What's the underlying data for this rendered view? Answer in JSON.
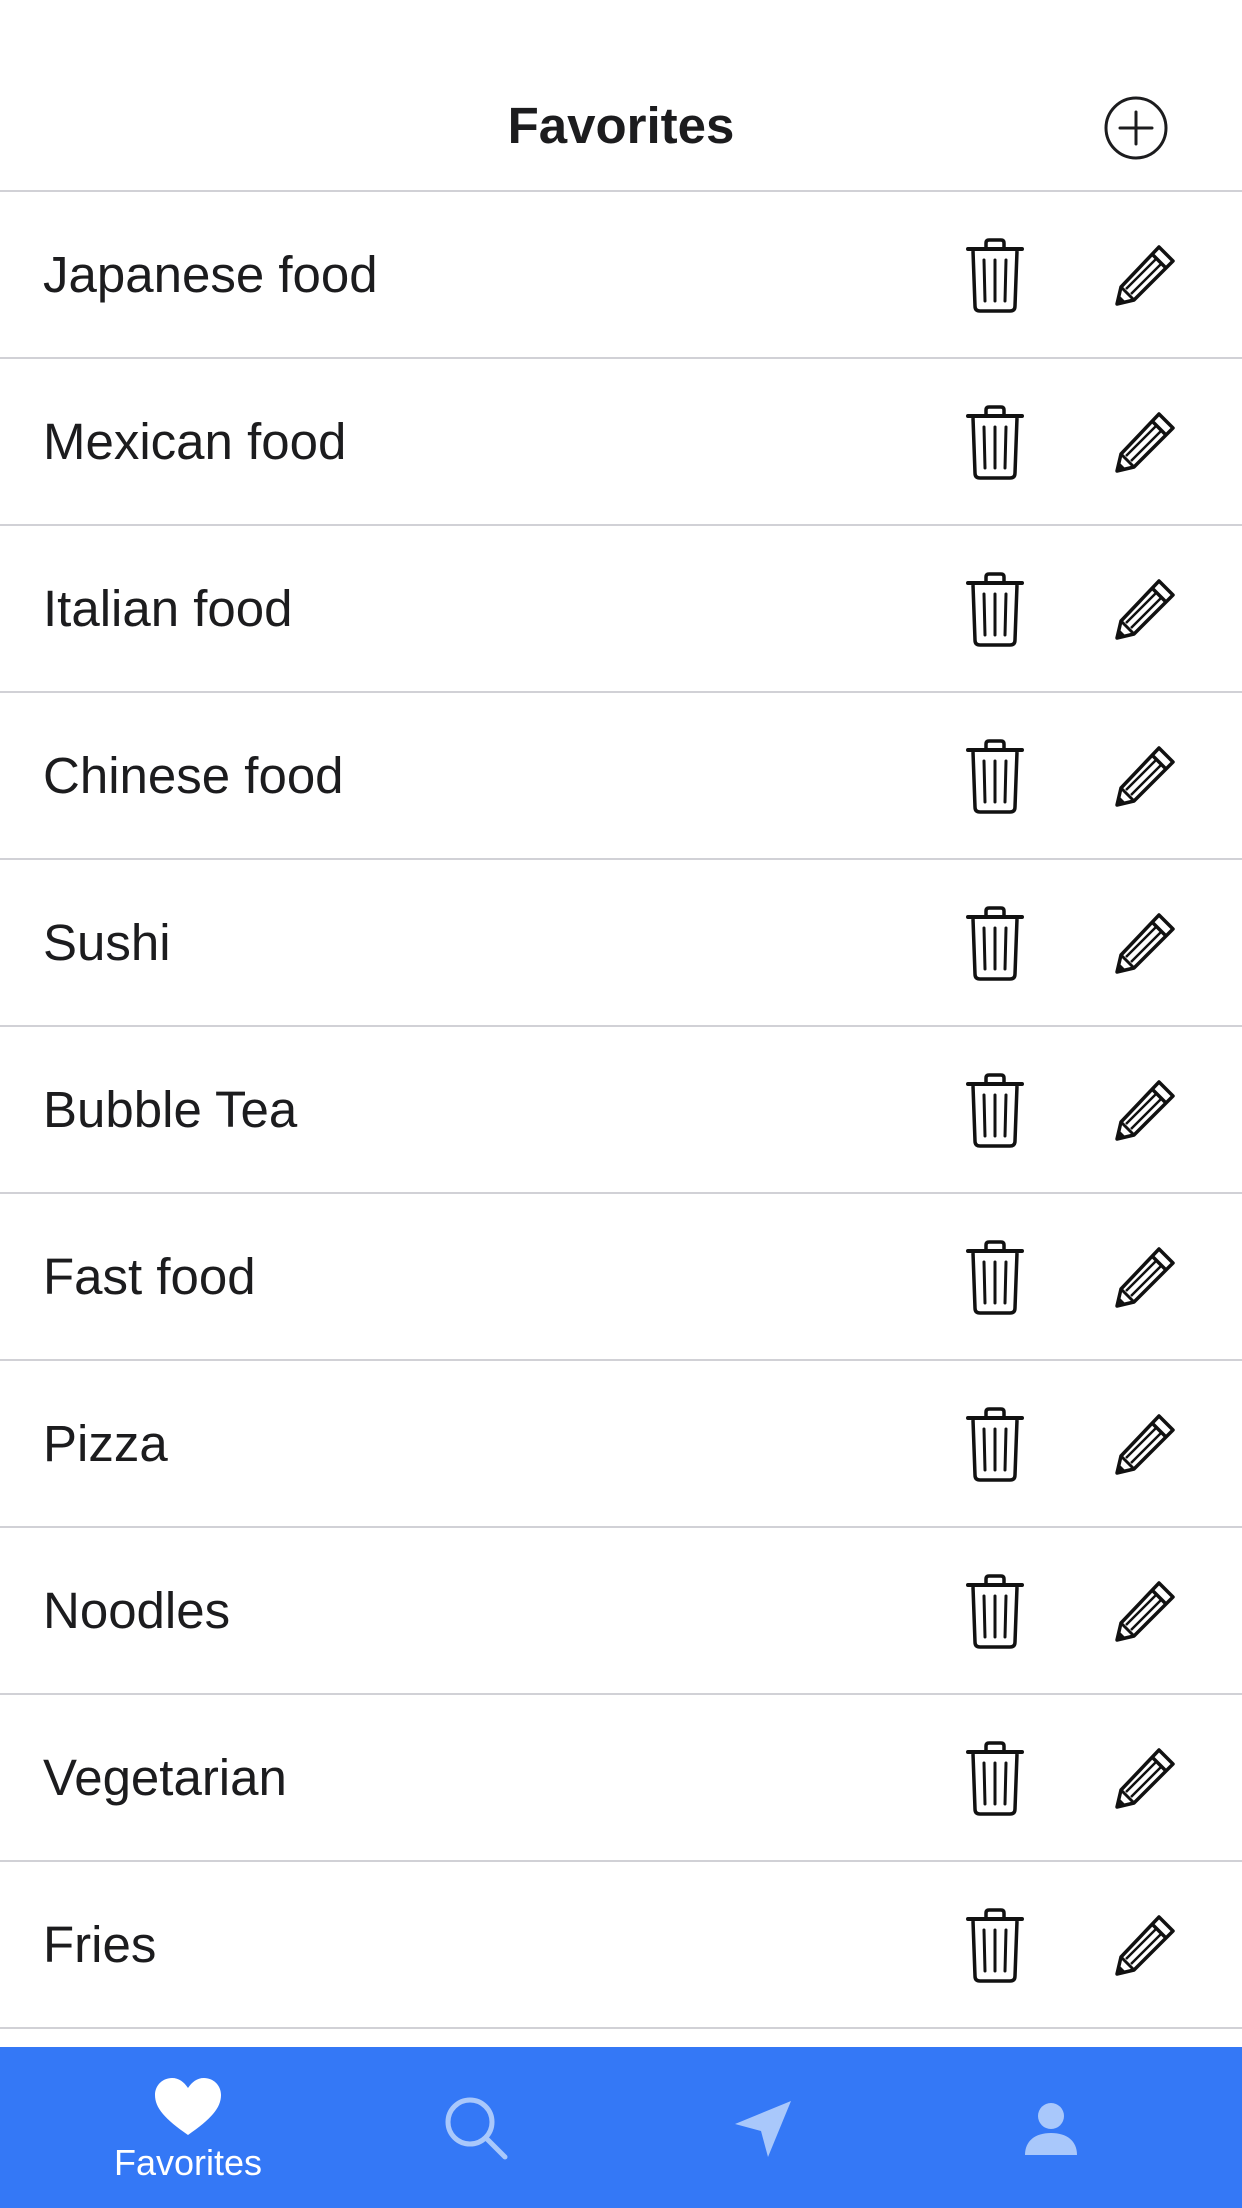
{
  "header": {
    "title": "Favorites",
    "add_icon": "plus-circle-icon"
  },
  "favorites": {
    "items": [
      {
        "label": "Japanese food"
      },
      {
        "label": "Mexican food"
      },
      {
        "label": "Italian food"
      },
      {
        "label": "Chinese food"
      },
      {
        "label": "Sushi"
      },
      {
        "label": "Bubble Tea"
      },
      {
        "label": "Fast food"
      },
      {
        "label": "Pizza"
      },
      {
        "label": "Noodles"
      },
      {
        "label": "Vegetarian"
      },
      {
        "label": "Fries"
      }
    ],
    "delete_icon": "trash-icon",
    "edit_icon": "pencil-icon"
  },
  "tabbar": {
    "tabs": [
      {
        "label": "Favorites",
        "icon": "heart-icon",
        "selected": true
      },
      {
        "label": "",
        "icon": "search-icon",
        "selected": false
      },
      {
        "label": "",
        "icon": "location-arrow-icon",
        "selected": false
      },
      {
        "label": "",
        "icon": "person-icon",
        "selected": false
      }
    ]
  },
  "colors": {
    "tabbar_background": "#3478f6",
    "tab_selected": "#ffffff",
    "tab_unselected": "#a9c8fb",
    "separator": "#d1d1d6",
    "text": "#1c1c1e"
  }
}
